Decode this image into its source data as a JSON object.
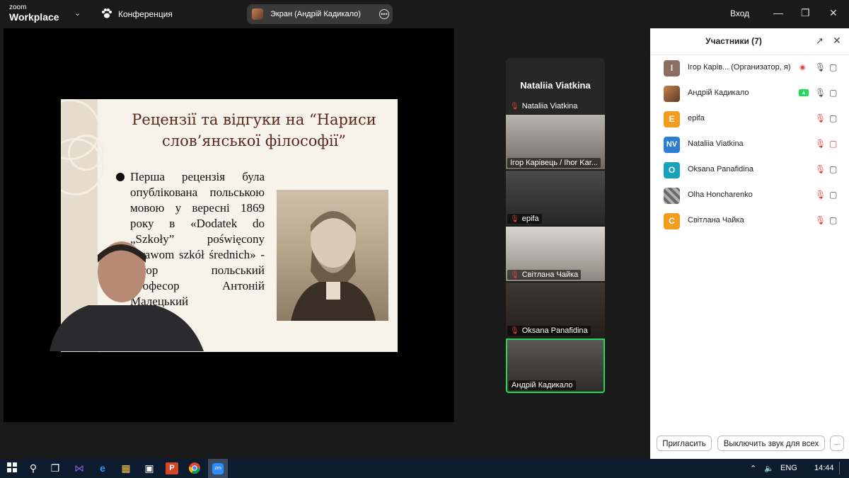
{
  "app": {
    "logo_line1": "zoom",
    "logo_line2": "Workplace",
    "meeting_label": "Конференция",
    "login": "Вход"
  },
  "screen_share": {
    "label": "Экран (Андрій Кадикало)"
  },
  "slide": {
    "title_line1": "Рецензії та відгуки на “Нариси",
    "title_line2": "слов’янської філософії”",
    "body": "Перша рецензія була опублікована польською мовою у вересні 1869 року в «Dodatek do „Szkoły” poświęcony sprawom szkół średnich» - автор польський професор Антоній Малецький"
  },
  "gallery": {
    "spotlight_name": "Nataliia Viatkina",
    "spotlight_sub": "Nataliia Viatkina",
    "tiles": [
      {
        "name": "Ігор Карівець / Ihor Kar...",
        "muted": false
      },
      {
        "name": "epifa",
        "muted": true
      },
      {
        "name": "Світлана Чайка",
        "muted": true
      },
      {
        "name": "Oksana Panafidina",
        "muted": true
      },
      {
        "name": "Андрій Кадикало",
        "muted": false
      }
    ]
  },
  "participants": {
    "title": "Участники (7)",
    "list": [
      {
        "initial": "I",
        "name": "Ігор Карів...  (Организатор, я)",
        "color": "#8a6e62"
      },
      {
        "initial": "",
        "name": "Андрій Кадикало",
        "color": "#7a5040"
      },
      {
        "initial": "E",
        "name": "epifa",
        "color": "#f39c1f"
      },
      {
        "initial": "NV",
        "name": "Nataliia Viatkina",
        "color": "#2d7dd2"
      },
      {
        "initial": "O",
        "name": "Oksana Panafidina",
        "color": "#16a2b8"
      },
      {
        "initial": "",
        "name": "Olha Honcharenko",
        "color": "#9a9a9a"
      },
      {
        "initial": "C",
        "name": "Світлана Чайка",
        "color": "#f39c1f"
      }
    ],
    "invite_button": "Пригласить",
    "mute_all_button": "Выключить звук для всех",
    "more_button": "···"
  },
  "taskbar": {
    "language": "ENG",
    "time": "14:44"
  },
  "colors": {
    "accent_green": "#23d959",
    "mute_red": "#e0433b",
    "panel_bg": "#ffffff",
    "taskbar_bg": "#0d1b2e"
  }
}
